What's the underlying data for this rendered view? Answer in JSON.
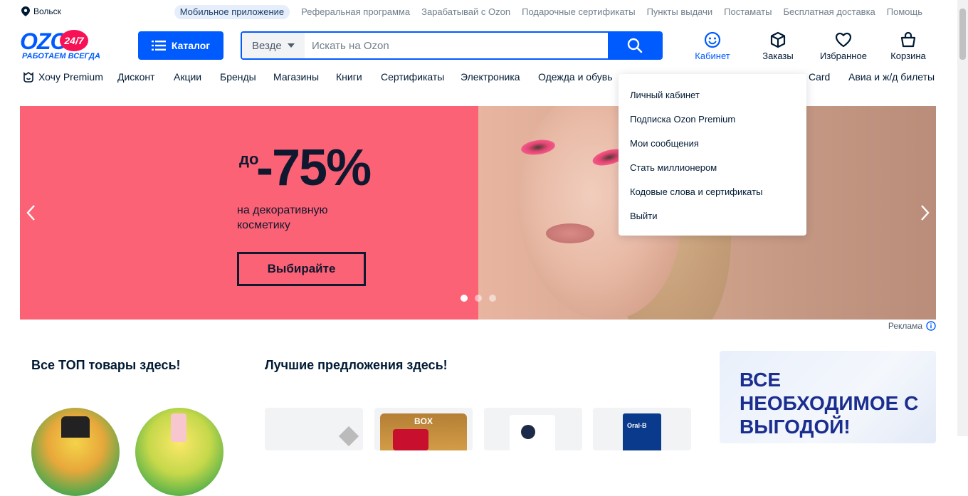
{
  "topbar": {
    "city": "Вольск",
    "links": [
      "Мобильное приложение",
      "Реферальная программа",
      "Зарабатывай с Ozon",
      "Подарочные сертификаты",
      "Пункты выдачи",
      "Постаматы",
      "Бесплатная доставка",
      "Помощь"
    ]
  },
  "logo": {
    "word": "OZON",
    "badge": "24/7",
    "tagline": "РАБОТАЕМ ВСЕГДА"
  },
  "catalog_label": "Каталог",
  "search": {
    "scope": "Везде",
    "placeholder": "Искать на Ozon"
  },
  "header_icons": [
    {
      "label": "Кабинет",
      "icon": "smile-icon",
      "active": true
    },
    {
      "label": "Заказы",
      "icon": "box-icon"
    },
    {
      "label": "Избранное",
      "icon": "heart-icon"
    },
    {
      "label": "Корзина",
      "icon": "bag-icon"
    }
  ],
  "nav": [
    "Хочу Premium",
    "Дисконт",
    "Акции",
    "Бренды",
    "Магазины",
    "Книги",
    "Сертификаты",
    "Электроника",
    "Одежда и обувь",
    "Card",
    "Авиа и ж/д билеты"
  ],
  "banner": {
    "pre": "до",
    "big": "-75%",
    "sub": "на декоративную косметику",
    "cta": "Выбирайте",
    "slides": 3,
    "active_slide": 1
  },
  "ad_label": "Реклама",
  "dropdown": [
    "Личный кабинет",
    "Подписка Ozon Premium",
    "Мои сообщения",
    "Стать миллионером",
    "Кодовые слова и сертификаты",
    "Выйти"
  ],
  "sections": {
    "top": "Все ТОП товары здесь!",
    "best": "Лучшие предложения здесь!",
    "promo": "ВСЕ НЕОБХОДИМОЕ С ВЫГОДОЙ!",
    "card_box_label": "BOX",
    "card_oralb_label": "Oral-B"
  },
  "colors": {
    "brand": "#005bff",
    "accent": "#f91155",
    "banner_bg": "#fc6275"
  }
}
